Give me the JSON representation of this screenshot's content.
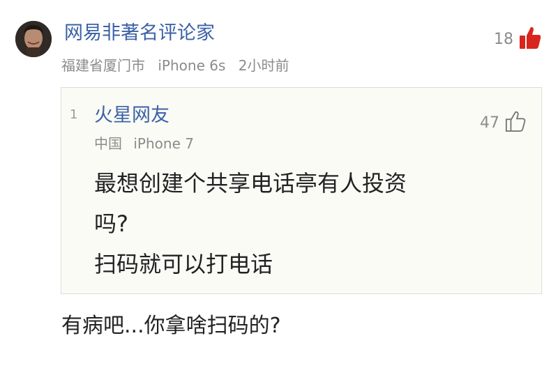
{
  "comment": {
    "username": "网易非著名评论家",
    "location": "福建省厦门市",
    "device": "iPhone 6s",
    "time": "2小时前",
    "likes": "18",
    "like_icon": "thumbs-up-filled-icon",
    "like_color": "#d9261c",
    "reply_text": "有病吧...你拿啥扫码的?"
  },
  "quoted": {
    "floor": "1",
    "username": "火星网友",
    "location": "中国",
    "device": "iPhone 7",
    "likes": "47",
    "like_icon": "thumbs-up-outline-icon",
    "content_lines": [
      "最想创建个共享电话亭有人投资",
      "吗?",
      "扫码就可以打电话"
    ]
  },
  "colors": {
    "username": "#3b62a6",
    "meta": "#8b8b8b",
    "text": "#222222",
    "quote_bg": "#fbfbf6"
  }
}
